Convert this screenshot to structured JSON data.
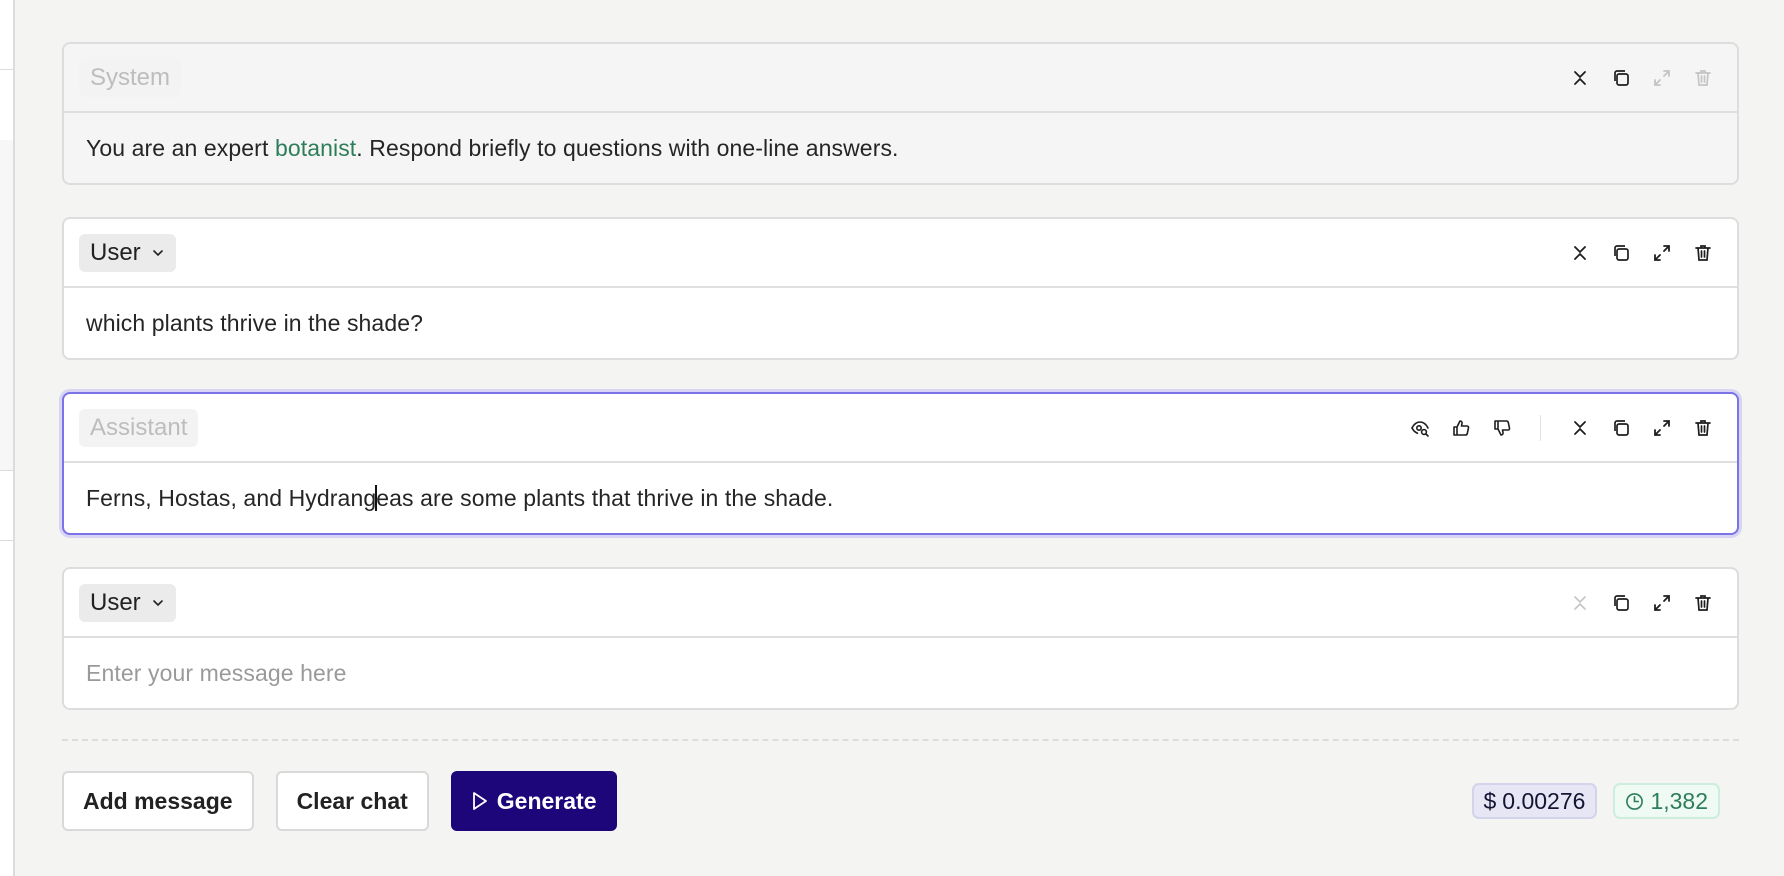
{
  "messages": [
    {
      "role": "System",
      "role_editable": false,
      "content_parts": [
        "You are an expert ",
        "botanist",
        ". Respond briefly to questions with one-line answers."
      ],
      "actions": {
        "collapse": "enabled",
        "copy": "enabled",
        "expand": "disabled",
        "delete": "disabled"
      }
    },
    {
      "role": "User",
      "role_editable": true,
      "content": "which plants thrive in the shade?",
      "actions": {
        "collapse": "enabled",
        "copy": "enabled",
        "expand": "enabled",
        "delete": "enabled"
      }
    },
    {
      "role": "Assistant",
      "role_editable": false,
      "active": true,
      "content_before_caret": "Ferns, Hostas, and Hydrang",
      "content_after_caret": "eas are some plants that thrive in the shade.",
      "feedback_actions": [
        "view-icon",
        "thumbs-up-icon",
        "thumbs-down-icon"
      ],
      "actions": {
        "collapse": "enabled",
        "copy": "enabled",
        "expand": "enabled",
        "delete": "enabled"
      }
    },
    {
      "role": "User",
      "role_editable": true,
      "content": "",
      "placeholder": "Enter your message here",
      "actions": {
        "collapse": "disabled",
        "copy": "enabled",
        "expand": "enabled",
        "delete": "enabled"
      }
    }
  ],
  "footer": {
    "add_message_label": "Add message",
    "clear_chat_label": "Clear chat",
    "generate_label": "Generate",
    "cost_symbol": "$",
    "cost_value": "0.00276",
    "token_count": "1,382"
  },
  "colors": {
    "accent": "#1d0679",
    "active_border": "#7b73e6",
    "highlight_green": "#2e7d5a"
  }
}
